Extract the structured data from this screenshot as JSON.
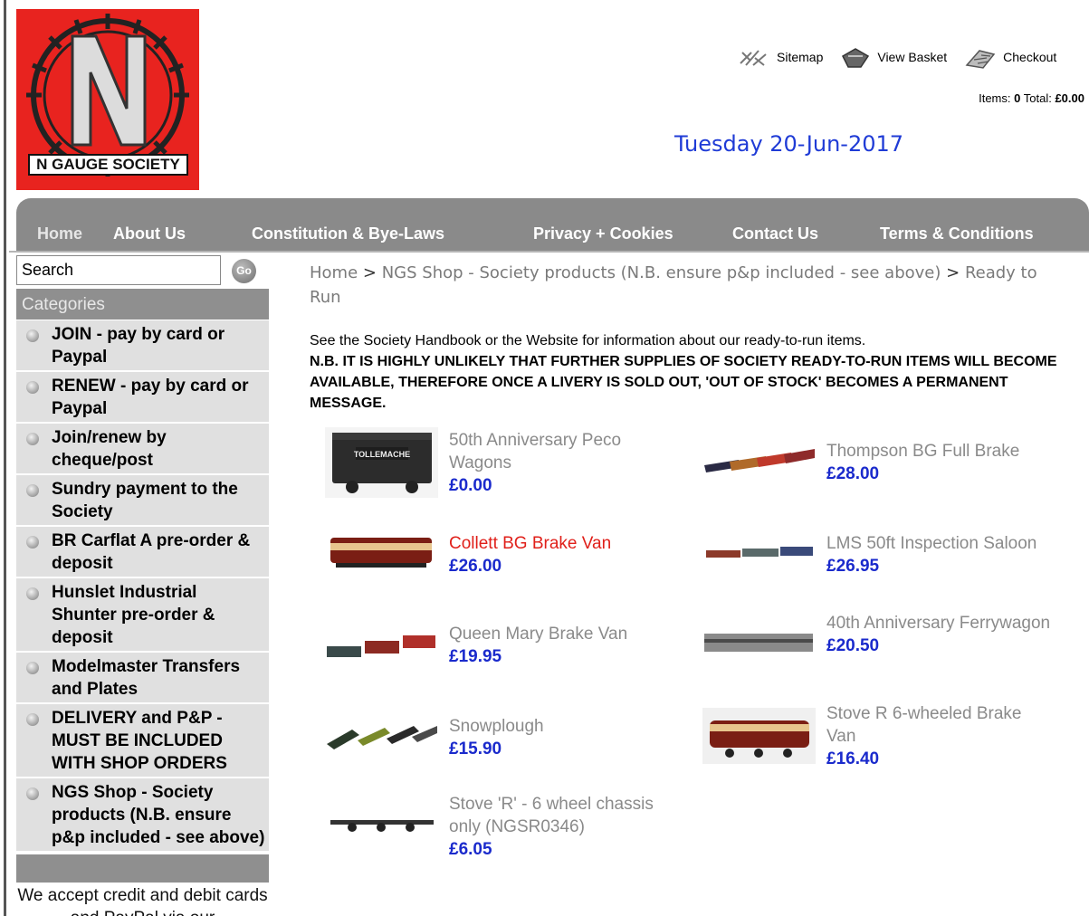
{
  "logo": {
    "brand_text": "N GAUGE SOCIETY",
    "colors": {
      "background": "#e8231f",
      "letter": "#dcdcdc"
    }
  },
  "header": {
    "links": [
      {
        "label": "Sitemap",
        "icon": "sitemap-icon"
      },
      {
        "label": "View Basket",
        "icon": "basket-icon"
      },
      {
        "label": "Checkout",
        "icon": "checkout-icon"
      }
    ],
    "basket": {
      "items_label": "Items:",
      "items_value": "0",
      "total_label": "Total:",
      "total_value": "£0.00"
    },
    "date": "Tuesday 20-Jun-2017"
  },
  "nav": {
    "items": [
      "Home",
      "About Us",
      "Constitution & Bye-Laws",
      "Privacy + Cookies",
      "Contact Us",
      "Terms & Conditions"
    ]
  },
  "sidebar": {
    "search_value": "Search",
    "go_label": "Go",
    "categories_title": "Categories",
    "categories": [
      "JOIN - pay by card or Paypal",
      "RENEW - pay by card or Paypal",
      "Join/renew by cheque/post",
      "Sundry payment to the Society",
      "BR Carflat A pre-order & deposit",
      "Hunslet Industrial Shunter pre-order & deposit",
      "Modelmaster Transfers and Plates",
      "DELIVERY and P&P - MUST BE INCLUDED WITH SHOP ORDERS",
      "NGS Shop - Society products (N.B. ensure p&p included - see above)"
    ],
    "note": "We accept credit and debit cards and PayPal via our"
  },
  "breadcrumb": {
    "home": "Home",
    "sep": ">",
    "category": "NGS Shop - Society products (N.B. ensure p&p included - see above)",
    "current": "Ready to Run"
  },
  "intro": {
    "line1": "See the Society Handbook or the Website for information about our ready-to-run items.",
    "warning": "N.B. IT IS HIGHLY UNLIKELY THAT FURTHER SUPPLIES OF SOCIETY READY-TO-RUN ITEMS WILL BECOME AVAILABLE, THEREFORE ONCE A LIVERY IS SOLD OUT,  'OUT OF STOCK' BECOMES A PERMANENT MESSAGE."
  },
  "products": [
    {
      "name": "50th Anniversary Peco Wagons",
      "price": "£0.00"
    },
    {
      "name": "Thompson BG Full Brake",
      "price": "£28.00"
    },
    {
      "name": "Collett BG Brake Van",
      "price": "£26.00",
      "highlight": true
    },
    {
      "name": "LMS 50ft Inspection Saloon",
      "price": "£26.95"
    },
    {
      "name": "Queen Mary Brake Van",
      "price": "£19.95"
    },
    {
      "name": "40th Anniversary Ferrywagon",
      "price": "£20.50"
    },
    {
      "name": "Snowplough",
      "price": "£15.90"
    },
    {
      "name": "Stove R 6-wheeled Brake Van",
      "price": "£16.40"
    },
    {
      "name": "Stove 'R' - 6 wheel chassis only (NGSR0346)",
      "price": "£6.05"
    }
  ],
  "wagon_lettering": "TOLLEMACHE",
  "colors": {
    "nav_bg": "#8a8a8a",
    "price": "#1a2acc",
    "date": "#1f3bd6",
    "active_product": "#e0201a"
  }
}
